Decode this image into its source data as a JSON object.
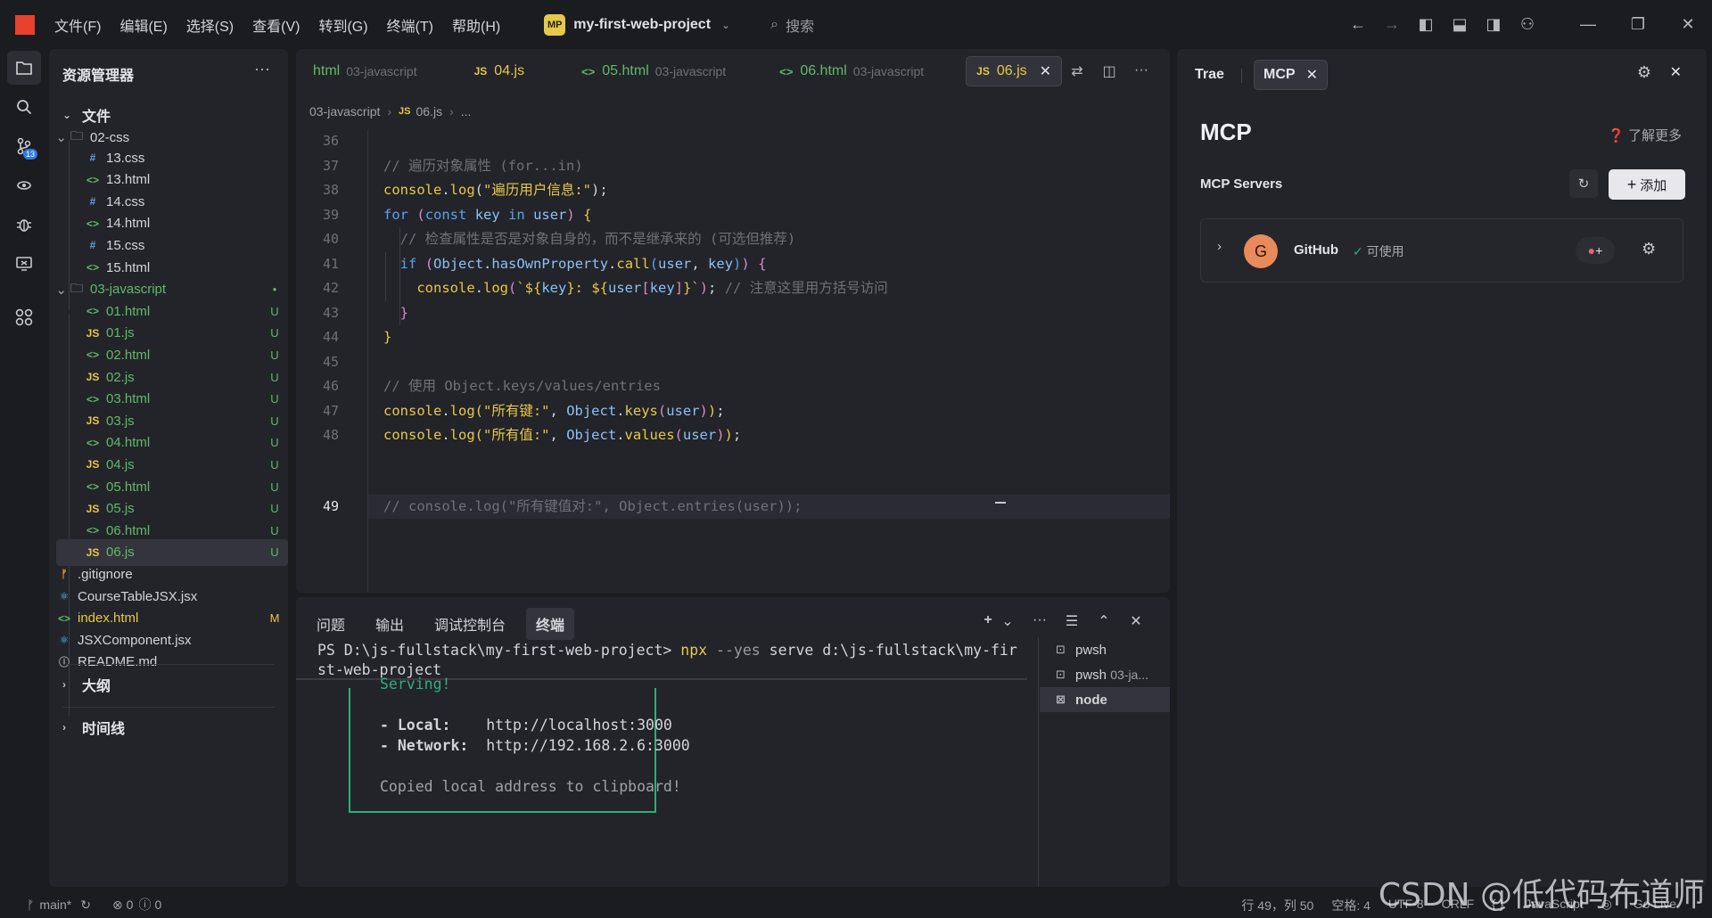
{
  "titlebar": {
    "menus": [
      "文件(F)",
      "编辑(E)",
      "选择(S)",
      "查看(V)",
      "转到(G)",
      "终端(T)",
      "帮助(H)"
    ],
    "project_badge": "MP",
    "project_name": "my-first-web-project",
    "search_placeholder": "搜索"
  },
  "activity": {
    "scm_count": "13"
  },
  "explorer": {
    "title": "资源管理器",
    "files_section": "文件",
    "outline_section": "大纲",
    "timeline_section": "时间线",
    "rows": [
      {
        "icon": "▸",
        "label": "02-css",
        "status": ""
      },
      {
        "icon": "#",
        "label": "13.css",
        "status": ""
      },
      {
        "icon": "<>",
        "label": "13.html",
        "status": ""
      },
      {
        "icon": "#",
        "label": "14.css",
        "status": ""
      },
      {
        "icon": "<>",
        "label": "14.html",
        "status": ""
      },
      {
        "icon": "#",
        "label": "15.css",
        "status": ""
      },
      {
        "icon": "<>",
        "label": "15.html",
        "status": ""
      },
      {
        "icon": "▸",
        "label": "03-javascript",
        "status": "•"
      },
      {
        "icon": "<>",
        "label": "01.html",
        "status": "U"
      },
      {
        "icon": "JS",
        "label": "01.js",
        "status": "U"
      },
      {
        "icon": "<>",
        "label": "02.html",
        "status": "U"
      },
      {
        "icon": "JS",
        "label": "02.js",
        "status": "U"
      },
      {
        "icon": "<>",
        "label": "03.html",
        "status": "U"
      },
      {
        "icon": "JS",
        "label": "03.js",
        "status": "U"
      },
      {
        "icon": "<>",
        "label": "04.html",
        "status": "U"
      },
      {
        "icon": "JS",
        "label": "04.js",
        "status": "U"
      },
      {
        "icon": "<>",
        "label": "05.html",
        "status": "U"
      },
      {
        "icon": "JS",
        "label": "05.js",
        "status": "U"
      },
      {
        "icon": "<>",
        "label": "06.html",
        "status": "U"
      },
      {
        "icon": "JS",
        "label": "06.js",
        "status": "U"
      },
      {
        "icon": "ᚠ",
        "label": ".gitignore",
        "status": ""
      },
      {
        "icon": "⚛",
        "label": "CourseTableJSX.jsx",
        "status": ""
      },
      {
        "icon": "<>",
        "label": "index.html",
        "status": "M"
      },
      {
        "icon": "⚛",
        "label": "JSXComponent.jsx",
        "status": ""
      },
      {
        "icon": "ⓘ",
        "label": "README.md",
        "status": ""
      }
    ]
  },
  "editor": {
    "tabs": [
      {
        "icon": "",
        "label": "html",
        "sub": "03-javascript"
      },
      {
        "icon": "JS",
        "label": "04.js",
        "sub": ""
      },
      {
        "icon": "<>",
        "label": "05.html",
        "sub": "03-javascript"
      },
      {
        "icon": "<>",
        "label": "06.html",
        "sub": "03-javascript"
      },
      {
        "icon": "JS",
        "label": "06.js",
        "sub": ""
      }
    ],
    "breadcrumb": [
      "03-javascript",
      "06.js",
      "..."
    ],
    "line_numbers": [
      "36",
      "37",
      "38",
      "39",
      "40",
      "41",
      "42",
      "43",
      "44",
      "45",
      "46",
      "47",
      "48",
      "49"
    ],
    "lines": [
      "",
      "// 遍历对象属性 (for...in)",
      "console.log(\"遍历用户信息:\");",
      "for (const key in user) {",
      "  // 检查属性是否是对象自身的，而不是继承来的 (可选但推荐)",
      "  if (Object.hasOwnProperty.call(user, key)) {",
      "    console.log(`${key}: ${user[key]}`); // 注意这里用方括号访问",
      "  }",
      "}",
      "",
      "// 使用 Object.keys/values/entries",
      "console.log(\"所有键:\", Object.keys(user));",
      "console.log(\"所有值:\", Object.values(user));",
      "// console.log(\"所有键值对:\", Object.entries(user));"
    ]
  },
  "terminal": {
    "tabs": [
      "问题",
      "输出",
      "调试控制台",
      "终端"
    ],
    "prompt": "PS D:\\js-fullstack\\my-first-web-project>",
    "cmd": "npx",
    "args": "--yes",
    "rest": "serve d:\\js-fullstack\\my-fir",
    "wrap": "st-web-project",
    "serving": "Serving!",
    "local_label": "- Local:",
    "local_url": "http://localhost:3000",
    "network_label": "- Network:",
    "network_url": "http://192.168.2.6:3000",
    "copied": "Copied local address to clipboard!",
    "sessions": [
      {
        "label": "pwsh",
        "sub": ""
      },
      {
        "label": "pwsh",
        "sub": "03-ja..."
      },
      {
        "label": "node",
        "sub": ""
      }
    ]
  },
  "side": {
    "tab_trae": "Trae",
    "tab_mcp": "MCP",
    "title": "MCP",
    "learn_more": "了解更多",
    "servers_label": "MCP Servers",
    "add_label": "添加",
    "server": {
      "avatar": "G",
      "name": "GitHub",
      "status": "可使用"
    }
  },
  "status": {
    "branch": "main*",
    "errors": "0",
    "warnings": "0",
    "position": "行 49，列 50",
    "spaces": "空格: 4",
    "encoding": "UTF-8",
    "eol": "CRLF",
    "language": "JavaScript",
    "golive": "Go Live"
  },
  "watermark": "CSDN @低代码布道师"
}
